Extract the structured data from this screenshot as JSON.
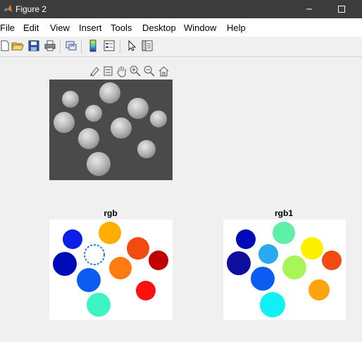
{
  "window": {
    "title": "Figure 2",
    "icon": "matlab-icon",
    "controls": [
      "minimize-icon",
      "maximize-icon"
    ]
  },
  "menu": {
    "items": [
      "File",
      "Edit",
      "View",
      "Insert",
      "Tools",
      "Desktop",
      "Window",
      "Help"
    ]
  },
  "toolbar": {
    "icons": [
      "new-figure-icon",
      "open-file-icon",
      "save-icon",
      "print-icon",
      "link-plot-icon",
      "insert-colorbar-icon",
      "insert-legend-icon",
      "edit-plot-icon",
      "property-inspector-icon"
    ]
  },
  "axes_toolbar": {
    "icons": [
      "brush-icon",
      "data-tips-icon",
      "pan-icon",
      "zoom-in-icon",
      "zoom-out-icon",
      "home-icon"
    ]
  },
  "axes": [
    {
      "title": "",
      "content": "grayscale-coins-image"
    },
    {
      "title": "rgb",
      "colors": [
        "#0b1fe8",
        "#ffae00",
        "#f24a10",
        "#0009b8",
        "#2c7be0",
        "#ff7a10",
        "#c00000",
        "#0b5cf0",
        "#ff1010",
        "#3cf5c3"
      ]
    },
    {
      "title": "rgb1",
      "colors": [
        "#0009b8",
        "#5ef0a8",
        "#fff000",
        "#0d0d9e",
        "#2aa8f0",
        "#a8f55a",
        "#f24a10",
        "#0b5cf0",
        "#ffa310",
        "#10f0f5"
      ]
    }
  ]
}
